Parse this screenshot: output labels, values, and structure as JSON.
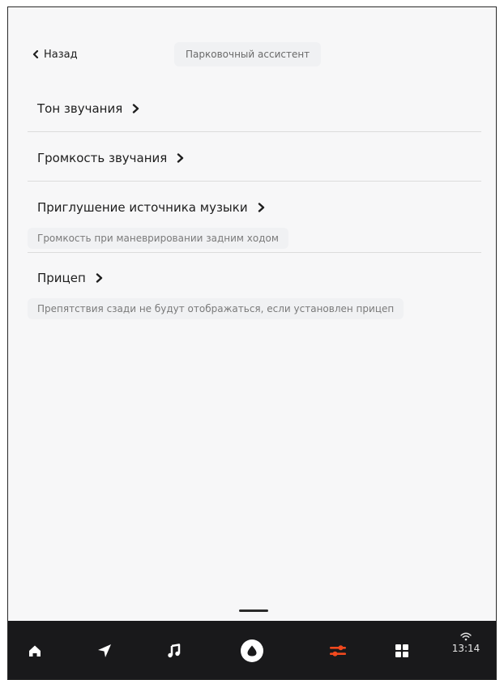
{
  "header": {
    "back_label": "Назад",
    "title": "Парковочный ассистент"
  },
  "settings": [
    {
      "label": "Тон звучания",
      "subtitle": ""
    },
    {
      "label": "Громкость звучания",
      "subtitle": ""
    },
    {
      "label": "Приглушение источника музыки",
      "subtitle": "Громкость при маневрировании задним ходом"
    },
    {
      "label": "Прицеп",
      "subtitle": "Препятствия сзади не будут отображаться, если установлен прицеп"
    }
  ],
  "dock": {
    "items": [
      "home-icon",
      "navigation-icon",
      "music-icon",
      "alice-icon",
      "settings-icon",
      "apps-icon"
    ],
    "active_item": "settings-icon",
    "time": "13:14"
  },
  "colors": {
    "accent": "#f0491e",
    "dock_background": "#19191b",
    "page_background": "#f7f7f8"
  }
}
